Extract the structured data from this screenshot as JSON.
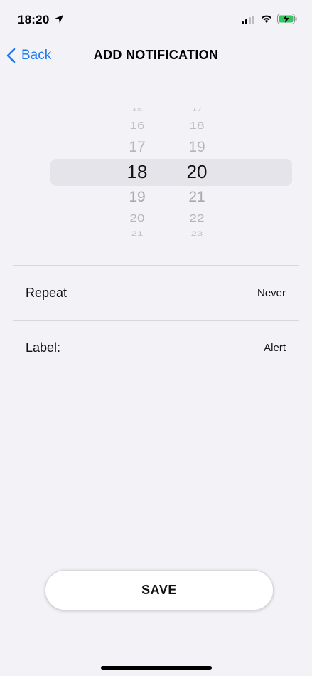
{
  "status_bar": {
    "time": "18:20",
    "icons": [
      "location-arrow-icon",
      "cellular-signal-icon",
      "wifi-icon",
      "battery-charging-icon"
    ]
  },
  "nav": {
    "back_label": "Back",
    "title": "ADD NOTIFICATION",
    "accent_color": "#1a7af0"
  },
  "picker": {
    "hours": [
      "15",
      "16",
      "17",
      "18",
      "19",
      "20",
      "21"
    ],
    "minutes": [
      "17",
      "18",
      "19",
      "20",
      "21",
      "22",
      "23"
    ],
    "selected_hour": "18",
    "selected_minute": "20"
  },
  "rows": [
    {
      "label": "Repeat",
      "value": "Never"
    },
    {
      "label": "Label:",
      "value": "Alert"
    }
  ],
  "save_label": "SAVE"
}
